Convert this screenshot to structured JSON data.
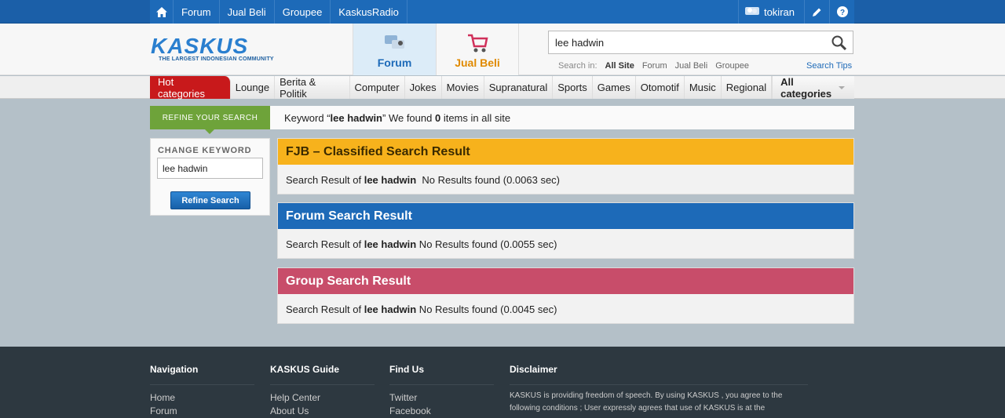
{
  "topbar": {
    "nav": [
      "Forum",
      "Jual Beli",
      "Groupee",
      "KaskusRadio"
    ],
    "username": "tokiran"
  },
  "header": {
    "logo_name": "KASKUS",
    "logo_tagline": "THE LARGEST INDONESIAN COMMUNITY",
    "tab_forum": "Forum",
    "tab_jualbeli": "Jual Beli",
    "search_value": "lee hadwin",
    "search_in_label": "Search in:",
    "search_in_options": [
      "All Site",
      "Forum",
      "Jual Beli",
      "Groupee"
    ],
    "search_tips": "Search Tips"
  },
  "categories": {
    "hot": "Hot categories",
    "items": [
      "Lounge",
      "Berita & Politik",
      "Computer",
      "Jokes",
      "Movies",
      "Supranatural",
      "Sports",
      "Games",
      "Otomotif",
      "Music",
      "Regional"
    ],
    "all": "All categories"
  },
  "refine": {
    "tab_label": "REFINE YOUR SEARCH",
    "change_keyword": "CHANGE KEYWORD",
    "keyword_value": "lee hadwin",
    "button": "Refine Search"
  },
  "keyword_bar": {
    "prefix": "Keyword “",
    "keyword": "lee hadwin",
    "middle": "” We found ",
    "count": "0",
    "suffix": " items in all site"
  },
  "results": [
    {
      "title": "FJB – Classified Search Result",
      "prefix": "Search Result of ",
      "keyword": "lee hadwin",
      "status": "  No Results found (0.0063 sec)"
    },
    {
      "title": "Forum Search Result",
      "prefix": "Search Result of ",
      "keyword": "lee hadwin",
      "status": " No Results found (0.0055 sec)"
    },
    {
      "title": "Group Search Result",
      "prefix": "Search Result of ",
      "keyword": "lee hadwin",
      "status": " No Results found (0.0045 sec)"
    }
  ],
  "footer": {
    "navigation": {
      "title": "Navigation",
      "items": [
        "Home",
        "Forum"
      ]
    },
    "guide": {
      "title": "KASKUS Guide",
      "items": [
        "Help Center",
        "About Us"
      ]
    },
    "findus": {
      "title": "Find Us",
      "items": [
        "Twitter",
        "Facebook"
      ]
    },
    "disclaimer": {
      "title": "Disclaimer",
      "text": "KASKUS is providing freedom of speech. By using KASKUS , you agree to the following conditions ; User expressly agrees that use of KASKUS is at the"
    }
  },
  "colors": {
    "brand_blue": "#1d6ab8",
    "fjb_yellow": "#f7b21c",
    "group_pink": "#c84d6a",
    "refine_green": "#6ea33a",
    "hot_red": "#c8191b"
  }
}
